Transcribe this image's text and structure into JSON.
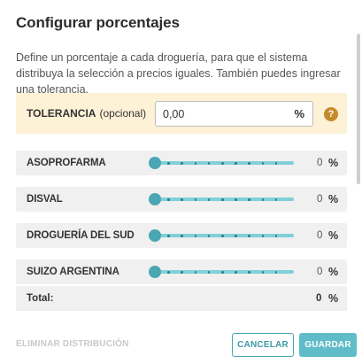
{
  "dialog": {
    "title": "Configurar porcentajes",
    "description": "Define un porcentaje a cada droguería, para que el sistema distribuya la selección a precios iguales. También puedes ingresar una tolerancia."
  },
  "tolerance": {
    "label": "TOLERANCIA",
    "optional": "(opcional)",
    "value": "0,00",
    "unit": "%",
    "help_icon": "question-mark-circle-icon",
    "help_glyph": "?"
  },
  "distributors": [
    {
      "name": "ASOPROFARMA",
      "value": "0",
      "unit": "%",
      "slider_fraction": 0
    },
    {
      "name": "DISVAL",
      "value": "0",
      "unit": "%",
      "slider_fraction": 0
    },
    {
      "name": "DROGUERÍA DEL SUD",
      "value": "0",
      "unit": "%",
      "slider_fraction": 0
    },
    {
      "name": "SUIZO ARGENTINA",
      "value": "0",
      "unit": "%",
      "slider_fraction": 0
    }
  ],
  "total": {
    "label": "Total:",
    "value": "0",
    "unit": "%"
  },
  "actions": {
    "clear": "ELIMINAR DISTRIBUCIÓN",
    "cancel": "CANCELAR",
    "save": "GUARDAR"
  },
  "colors": {
    "accent": "#4aa6b3",
    "tolerance_bg": "#fdf1d6",
    "help_icon": "#c48a2c",
    "save_bg": "#5fbcc8"
  }
}
